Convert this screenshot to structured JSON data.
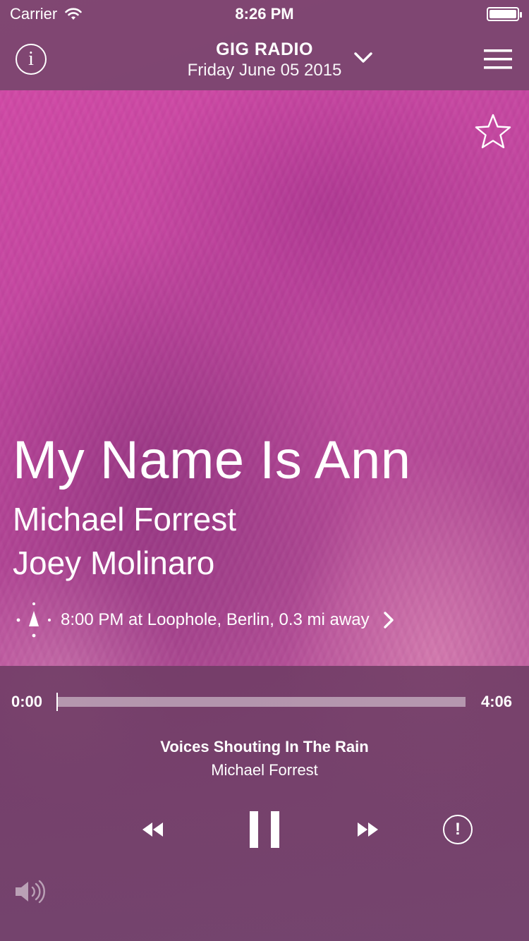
{
  "status_bar": {
    "carrier": "Carrier",
    "time": "8:26 PM",
    "wifi_icon": "wifi-icon",
    "battery_icon": "battery-icon"
  },
  "header": {
    "title": "GIG RADIO",
    "date": "Friday June 05 2015",
    "info_icon": "info-icon",
    "info_glyph": "i",
    "dropdown_icon": "chevron-down-icon",
    "menu_icon": "hamburger-menu-icon"
  },
  "favorite": {
    "icon": "star-outline-icon"
  },
  "track": {
    "title": "My Name Is Ann",
    "artists": [
      "Michael Forrest",
      "Joey Molinaro"
    ]
  },
  "event": {
    "icon": "compass-icon",
    "text": "8:00 PM at Loophole, Berlin, 0.3 mi away",
    "chevron_icon": "chevron-right-icon"
  },
  "player": {
    "elapsed": "0:00",
    "duration": "4:06",
    "progress": 0,
    "now_playing_title": "Voices Shouting In The Rain",
    "now_playing_artist": "Michael Forrest",
    "controls": {
      "rewind_icon": "rewind-icon",
      "pause_icon": "pause-icon",
      "fast_forward_icon": "fast-forward-icon",
      "report_icon": "exclamation-circle-icon",
      "report_glyph": "!"
    },
    "volume_icon": "speaker-icon"
  },
  "colors": {
    "accent_pink": "#d64aa8",
    "panel": "#7a4a72",
    "text": "#ffffff"
  }
}
